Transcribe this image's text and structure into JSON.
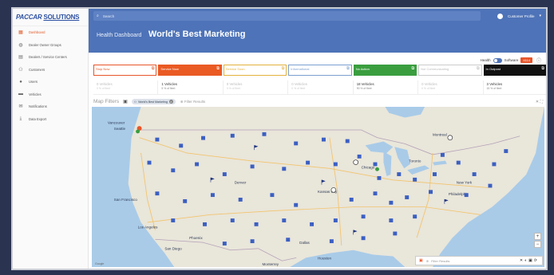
{
  "brand": {
    "part1": "PACCAR",
    "part2": "SOLUTIONS"
  },
  "sidebar": {
    "items": [
      {
        "label": "Dashboard",
        "icon": "grid-icon"
      },
      {
        "label": "Dealer Owner Groups",
        "icon": "globe-icon"
      },
      {
        "label": "Dealers / Service Centers",
        "icon": "building-icon"
      },
      {
        "label": "Customers",
        "icon": "people-icon"
      },
      {
        "label": "Users",
        "icon": "user-icon"
      },
      {
        "label": "Vehicles",
        "icon": "truck-icon"
      },
      {
        "label": "Notifications",
        "icon": "envelope-icon"
      },
      {
        "label": "Data Export",
        "icon": "download-icon"
      }
    ]
  },
  "topbar": {
    "search_placeholder": "Search",
    "profile_label": "Customer Profile"
  },
  "header": {
    "section": "Health Dashboard",
    "title": "World's Best Marketing"
  },
  "toggles": {
    "health": "Health",
    "software": "Software",
    "count": "4114"
  },
  "cards": [
    {
      "label": "Stop Now",
      "bg": "#ffffff",
      "fg": "#e05a2a",
      "border": "#e8552a"
    },
    {
      "label": "Service Now",
      "bg": "#ea5a23",
      "fg": "#ffffff",
      "border": "#ea5a23"
    },
    {
      "label": "Service Soon",
      "bg": "#ffffff",
      "fg": "#e3b23c",
      "border": "#e3b23c"
    },
    {
      "label": "Informational",
      "bg": "#ffffff",
      "fg": "#7b9fd0",
      "border": "#7b9fd0"
    },
    {
      "label": "No Action",
      "bg": "#3a9e3f",
      "fg": "#ffffff",
      "border": "#3a9e3f"
    },
    {
      "label": "Not Communicating",
      "bg": "#ffffff",
      "fg": "#bbbbbb",
      "border": "#cccccc"
    },
    {
      "label": "In Outpost",
      "bg": "#111111",
      "fg": "#ffffff",
      "border": "#111111"
    }
  ],
  "stats": [
    {
      "value": "0 Vehicles",
      "sub": "0 % of fleet",
      "dark": false
    },
    {
      "value": "1 Vehicles",
      "sub": "5 % of fleet",
      "dark": true
    },
    {
      "value": "0 Vehicles",
      "sub": "0 % of fleet",
      "dark": false
    },
    {
      "value": "0 Vehicles",
      "sub": "0 % of fleet",
      "dark": false
    },
    {
      "value": "18 Vehicles",
      "sub": "90 % of fleet",
      "dark": true
    },
    {
      "value": "0 Vehicles",
      "sub": "0 % of fleet",
      "dark": false
    },
    {
      "value": "3 Vehicles",
      "sub": "15 % of fleet",
      "dark": true
    }
  ],
  "filters": {
    "label": "Map Filters",
    "chip": "World's Best Marketing",
    "add_label": "Filter Results"
  },
  "map": {
    "cities": [
      "Vancouver",
      "Seattle",
      "San Francisco",
      "Los Angeles",
      "Phoenix",
      "Denver",
      "Kansas City",
      "Chicago",
      "Montreal",
      "Toronto",
      "New York",
      "Philadelphia",
      "Dallas",
      "Houston",
      "Monterrey",
      "San Diego"
    ],
    "google": "Google"
  },
  "bottom": {
    "placeholder": "Filter Results"
  }
}
